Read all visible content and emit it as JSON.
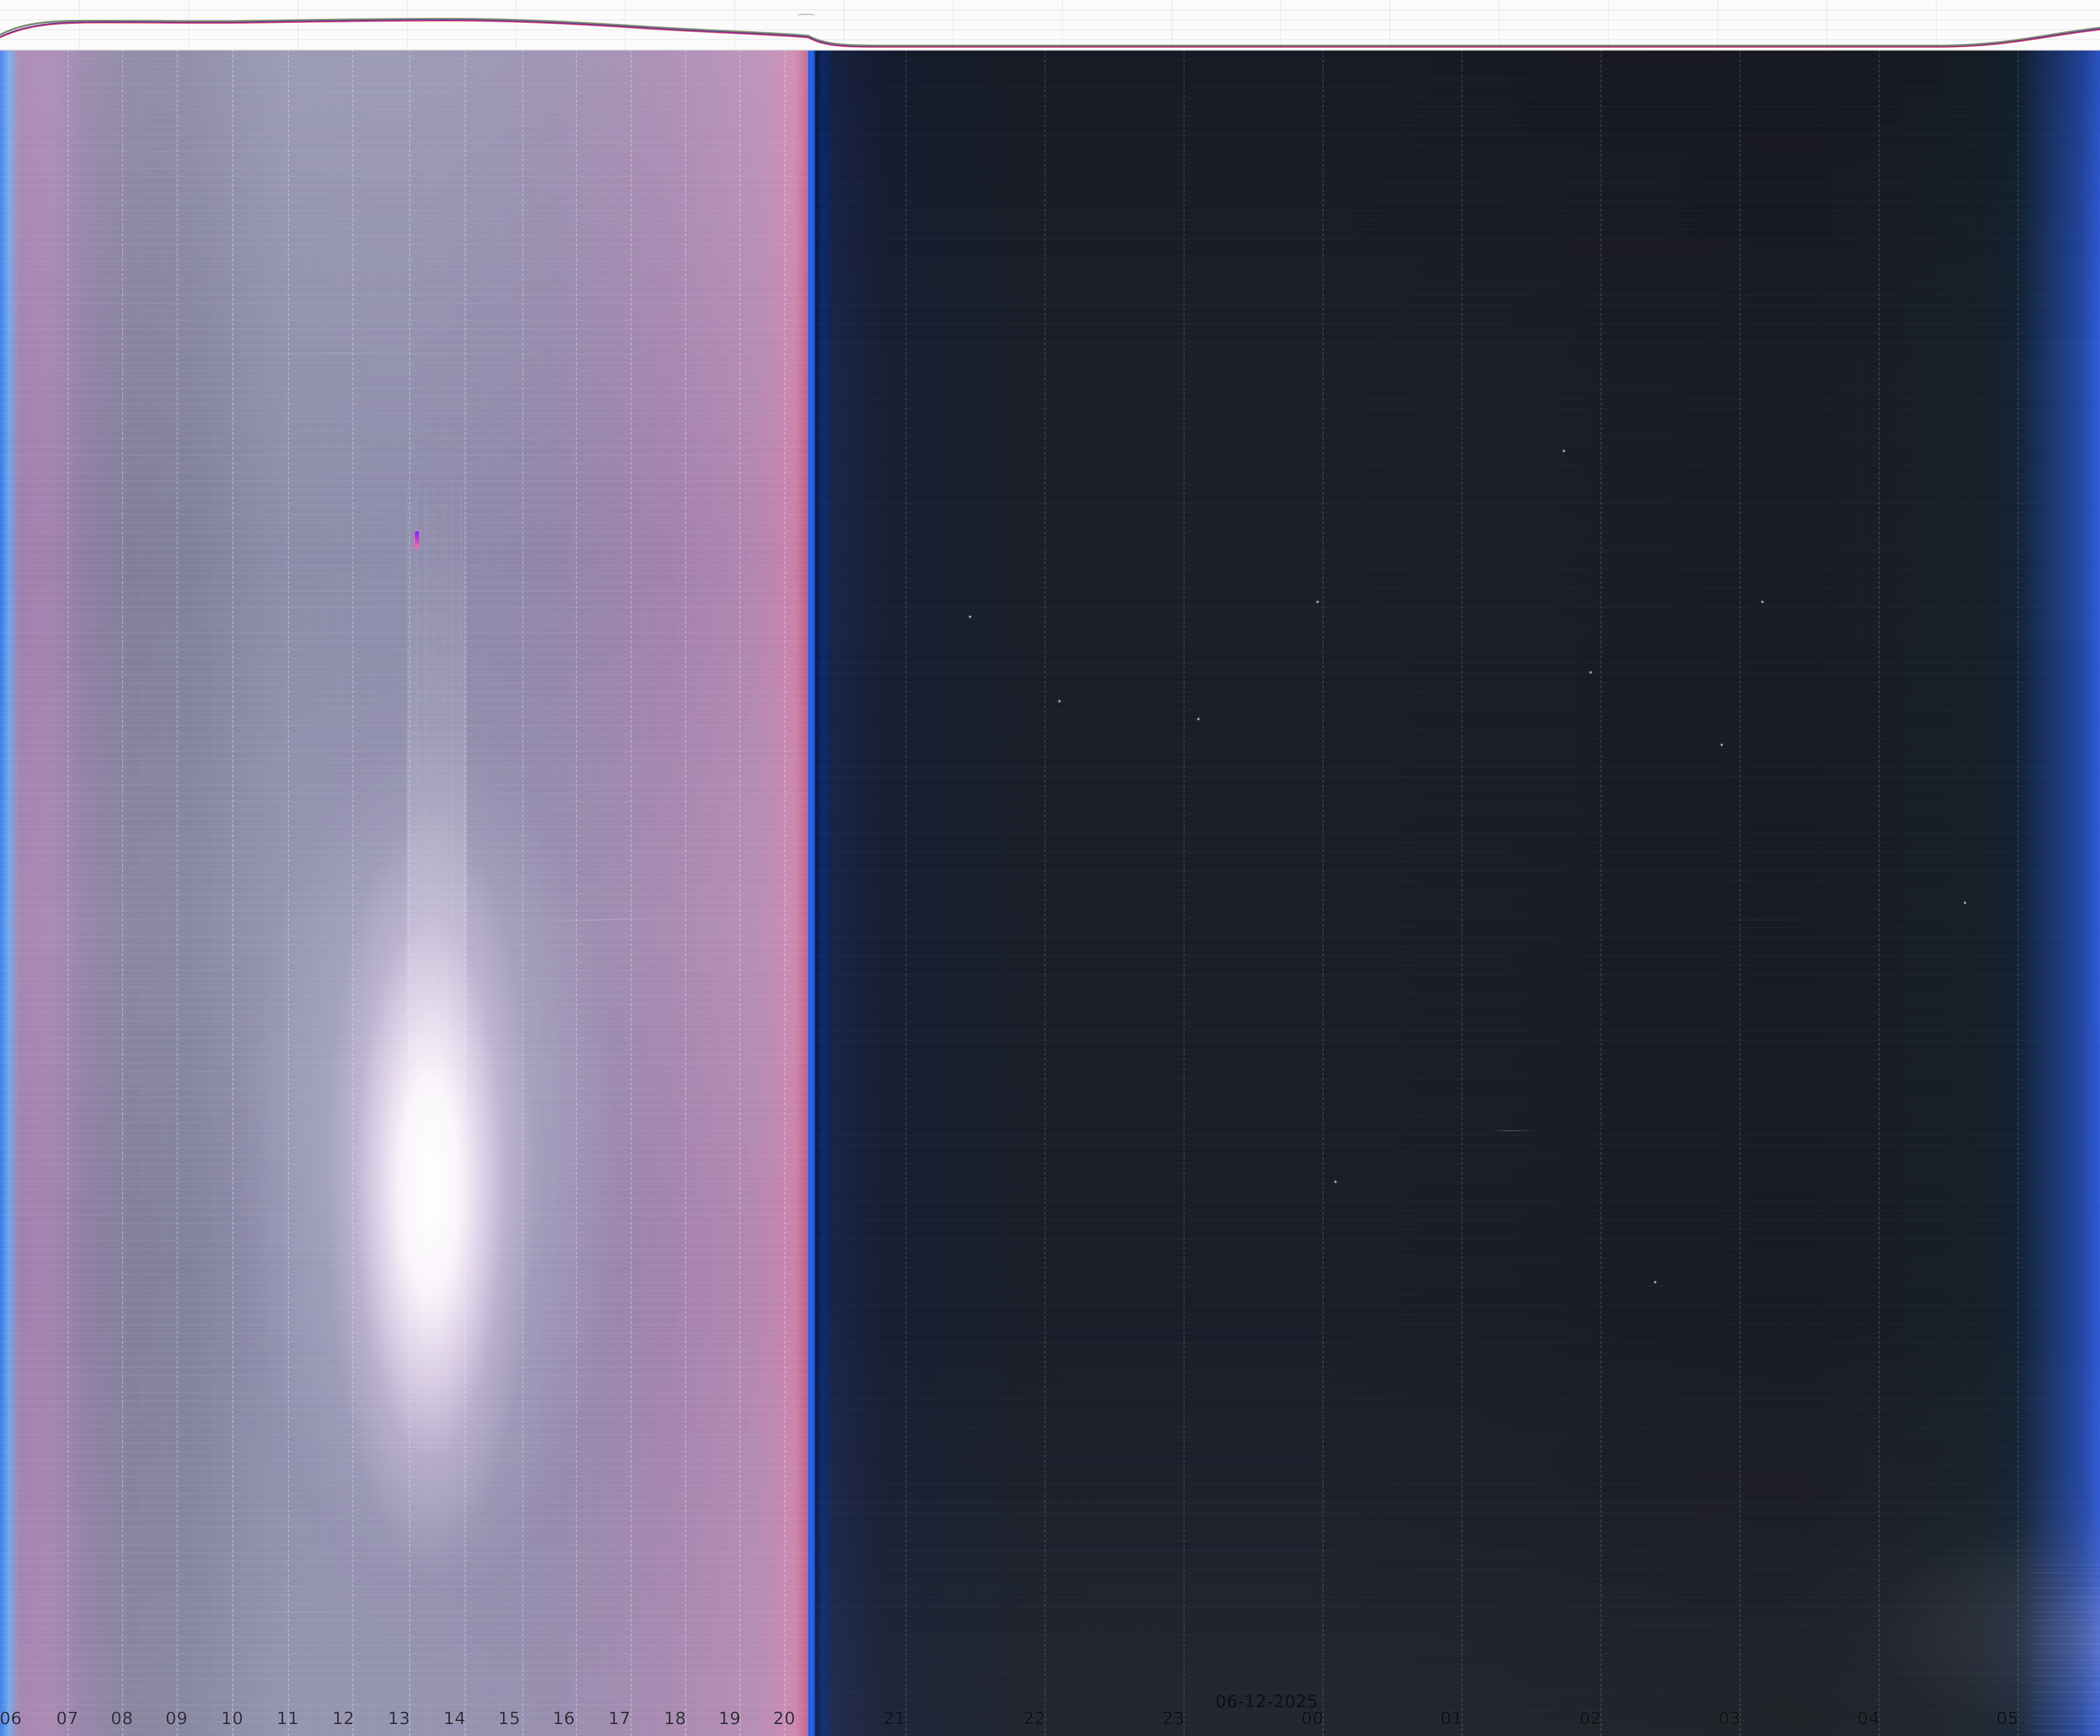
{
  "top_strip": {
    "visible_text": "..."
  },
  "axis": {
    "hours": [
      "06",
      "07",
      "08",
      "09",
      "10",
      "11",
      "12",
      "13",
      "14",
      "15",
      "16",
      "17",
      "18",
      "19",
      "20",
      "21",
      "22",
      "23",
      "00",
      "01",
      "02",
      "03",
      "04",
      "05"
    ],
    "date": "06-12-2025"
  },
  "colors": {
    "day_accent": "#9d7cac",
    "night_accent": "#1b1f2a",
    "divider_blue": "#2266ff",
    "sun_glow": "#ffffff",
    "moon_glow": "#fff5ff"
  }
}
